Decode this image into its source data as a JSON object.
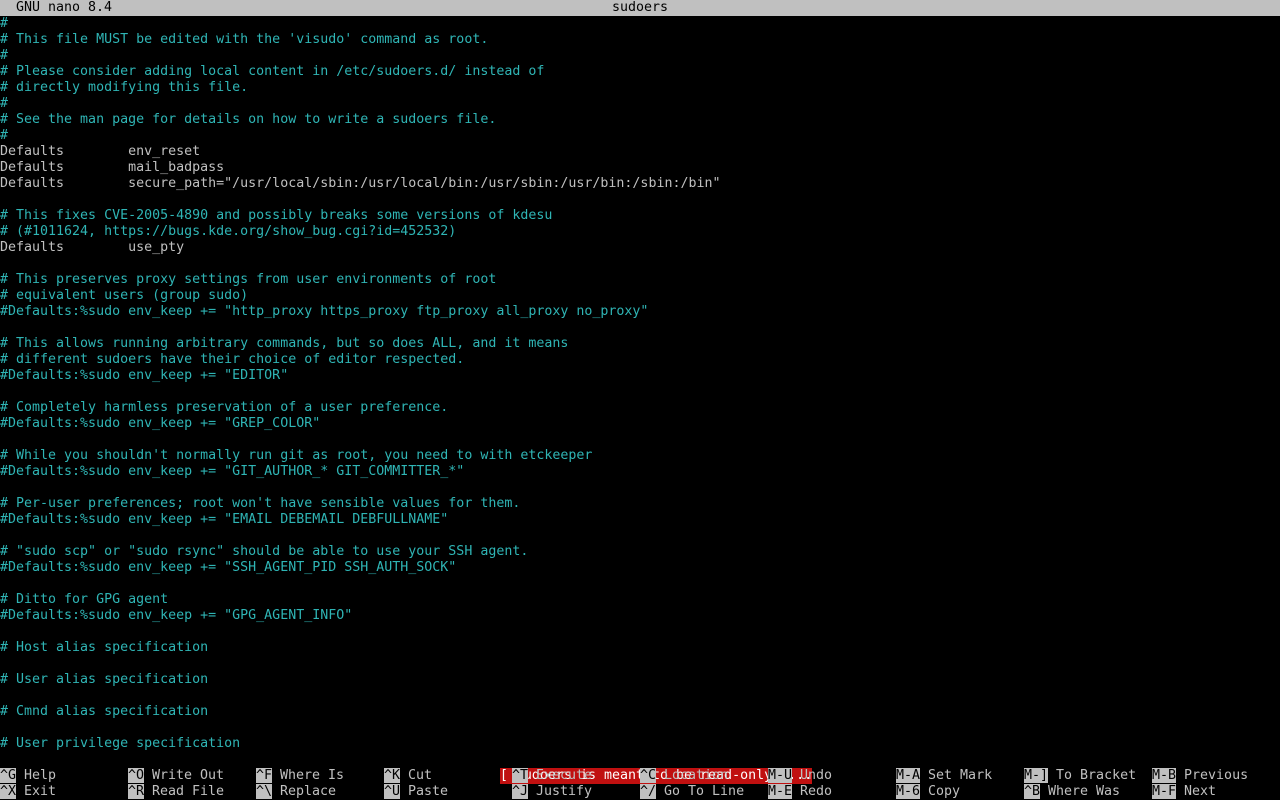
{
  "titlebar": {
    "app": "GNU nano 8.4",
    "filename": "sudoers"
  },
  "editor": {
    "lines": [
      {
        "text": "#",
        "kind": "comment"
      },
      {
        "text": "# This file MUST be edited with the 'visudo' command as root.",
        "kind": "comment"
      },
      {
        "text": "#",
        "kind": "comment"
      },
      {
        "text": "# Please consider adding local content in /etc/sudoers.d/ instead of",
        "kind": "comment"
      },
      {
        "text": "# directly modifying this file.",
        "kind": "comment"
      },
      {
        "text": "#",
        "kind": "comment"
      },
      {
        "text": "# See the man page for details on how to write a sudoers file.",
        "kind": "comment"
      },
      {
        "text": "#",
        "kind": "comment"
      },
      {
        "text": "Defaults        env_reset",
        "kind": "normal"
      },
      {
        "text": "Defaults        mail_badpass",
        "kind": "normal"
      },
      {
        "text": "Defaults        secure_path=\"/usr/local/sbin:/usr/local/bin:/usr/sbin:/usr/bin:/sbin:/bin\"",
        "kind": "normal"
      },
      {
        "text": "",
        "kind": "normal"
      },
      {
        "text": "# This fixes CVE-2005-4890 and possibly breaks some versions of kdesu",
        "kind": "comment"
      },
      {
        "text": "# (#1011624, https://bugs.kde.org/show_bug.cgi?id=452532)",
        "kind": "comment"
      },
      {
        "text": "Defaults        use_pty",
        "kind": "normal"
      },
      {
        "text": "",
        "kind": "normal"
      },
      {
        "text": "# This preserves proxy settings from user environments of root",
        "kind": "comment"
      },
      {
        "text": "# equivalent users (group sudo)",
        "kind": "comment"
      },
      {
        "text": "#Defaults:%sudo env_keep += \"http_proxy https_proxy ftp_proxy all_proxy no_proxy\"",
        "kind": "comment"
      },
      {
        "text": "",
        "kind": "normal"
      },
      {
        "text": "# This allows running arbitrary commands, but so does ALL, and it means",
        "kind": "comment"
      },
      {
        "text": "# different sudoers have their choice of editor respected.",
        "kind": "comment"
      },
      {
        "text": "#Defaults:%sudo env_keep += \"EDITOR\"",
        "kind": "comment"
      },
      {
        "text": "",
        "kind": "normal"
      },
      {
        "text": "# Completely harmless preservation of a user preference.",
        "kind": "comment"
      },
      {
        "text": "#Defaults:%sudo env_keep += \"GREP_COLOR\"",
        "kind": "comment"
      },
      {
        "text": "",
        "kind": "normal"
      },
      {
        "text": "# While you shouldn't normally run git as root, you need to with etckeeper",
        "kind": "comment"
      },
      {
        "text": "#Defaults:%sudo env_keep += \"GIT_AUTHOR_* GIT_COMMITTER_*\"",
        "kind": "comment"
      },
      {
        "text": "",
        "kind": "normal"
      },
      {
        "text": "# Per-user preferences; root won't have sensible values for them.",
        "kind": "comment"
      },
      {
        "text": "#Defaults:%sudo env_keep += \"EMAIL DEBEMAIL DEBFULLNAME\"",
        "kind": "comment"
      },
      {
        "text": "",
        "kind": "normal"
      },
      {
        "text": "# \"sudo scp\" or \"sudo rsync\" should be able to use your SSH agent.",
        "kind": "comment"
      },
      {
        "text": "#Defaults:%sudo env_keep += \"SSH_AGENT_PID SSH_AUTH_SOCK\"",
        "kind": "comment"
      },
      {
        "text": "",
        "kind": "normal"
      },
      {
        "text": "# Ditto for GPG agent",
        "kind": "comment"
      },
      {
        "text": "#Defaults:%sudo env_keep += \"GPG_AGENT_INFO\"",
        "kind": "comment"
      },
      {
        "text": "",
        "kind": "normal"
      },
      {
        "text": "# Host alias specification",
        "kind": "comment"
      },
      {
        "text": "",
        "kind": "normal"
      },
      {
        "text": "# User alias specification",
        "kind": "comment"
      },
      {
        "text": "",
        "kind": "normal"
      },
      {
        "text": "# Cmnd alias specification",
        "kind": "comment"
      },
      {
        "text": "",
        "kind": "normal"
      },
      {
        "text": "# User privilege specification",
        "kind": "comment"
      }
    ]
  },
  "status": {
    "message": "[ sudoers is meant to be read-only ]..."
  },
  "shortcuts": {
    "row1": [
      {
        "key": "^G",
        "label": "Help"
      },
      {
        "key": "^O",
        "label": "Write Out"
      },
      {
        "key": "^F",
        "label": "Where Is"
      },
      {
        "key": "^K",
        "label": "Cut"
      },
      {
        "key": "^T",
        "label": "Execute"
      },
      {
        "key": "^C",
        "label": "Location"
      },
      {
        "key": "M-U",
        "label": "Undo"
      },
      {
        "key": "M-A",
        "label": "Set Mark"
      },
      {
        "key": "M-]",
        "label": "To Bracket"
      },
      {
        "key": "M-B",
        "label": "Previous"
      }
    ],
    "row2": [
      {
        "key": "^X",
        "label": "Exit"
      },
      {
        "key": "^R",
        "label": "Read File"
      },
      {
        "key": "^\\",
        "label": "Replace"
      },
      {
        "key": "^U",
        "label": "Paste"
      },
      {
        "key": "^J",
        "label": "Justify"
      },
      {
        "key": "^/",
        "label": "Go To Line"
      },
      {
        "key": "M-E",
        "label": "Redo"
      },
      {
        "key": "M-6",
        "label": "Copy"
      },
      {
        "key": "^B",
        "label": "Where Was"
      },
      {
        "key": "M-F",
        "label": "Next"
      }
    ]
  },
  "colors": {
    "background": "#000000",
    "comment": "#2fb5b5",
    "text": "#c0c0c0",
    "titlebar_bg": "#c0c0c0",
    "status_bg": "#c01010"
  }
}
